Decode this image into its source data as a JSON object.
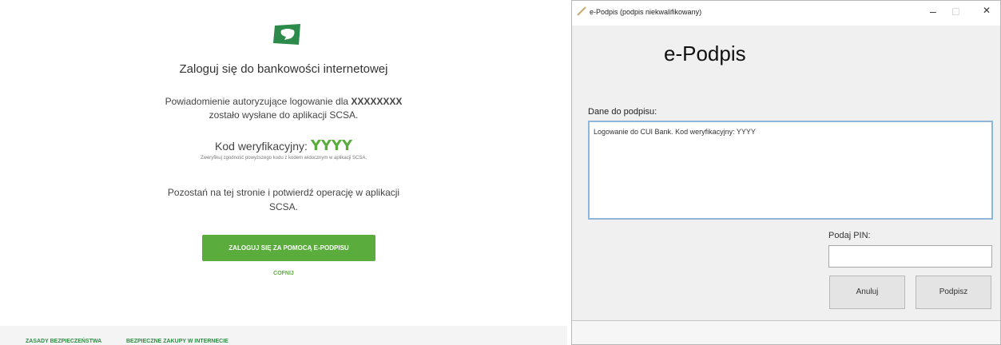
{
  "login": {
    "title": "Zaloguj się do bankowości internetowej",
    "notice_prefix": "Powiadomienie autoryzujące logowanie dla",
    "user": "XXXXXXXX",
    "notice_suffix": "zostało wysłane do aplikacji SCSA.",
    "code_label": "Kod weryfikacyjny:",
    "code": "YYYY",
    "verify_hint": "Zweryfikuj zgodność powyższego kodu z kodem widocznym w aplikacji SCSA.",
    "stay_line1": "Pozostań na tej stronie i potwierdź operację w aplikacji",
    "stay_line2": "SCSA.",
    "login_button": "ZALOGUJ SIĘ ZA POMOCĄ E-PODPISU",
    "back_link": "COFNIJ"
  },
  "footer": {
    "link1": "ZASADY BEZPIECZEŃSTWA",
    "link2": "BEZPIECZNE ZAKUPY W INTERNECIE"
  },
  "dialog": {
    "window_title": "e-Podpis (podpis niekwalifikowany)",
    "heading": "e-Podpis",
    "data_label": "Dane do podpisu:",
    "data_text": "Logowanie do CUI Bank. Kod weryfikacyjny: YYYY",
    "pin_label": "Podaj PIN:",
    "pin_value": "",
    "cancel_label": "Anuluj",
    "sign_label": "Podpisz",
    "minimize": "–",
    "maximize": "□",
    "close": "✕"
  },
  "colors": {
    "accent": "#5aac3c"
  }
}
